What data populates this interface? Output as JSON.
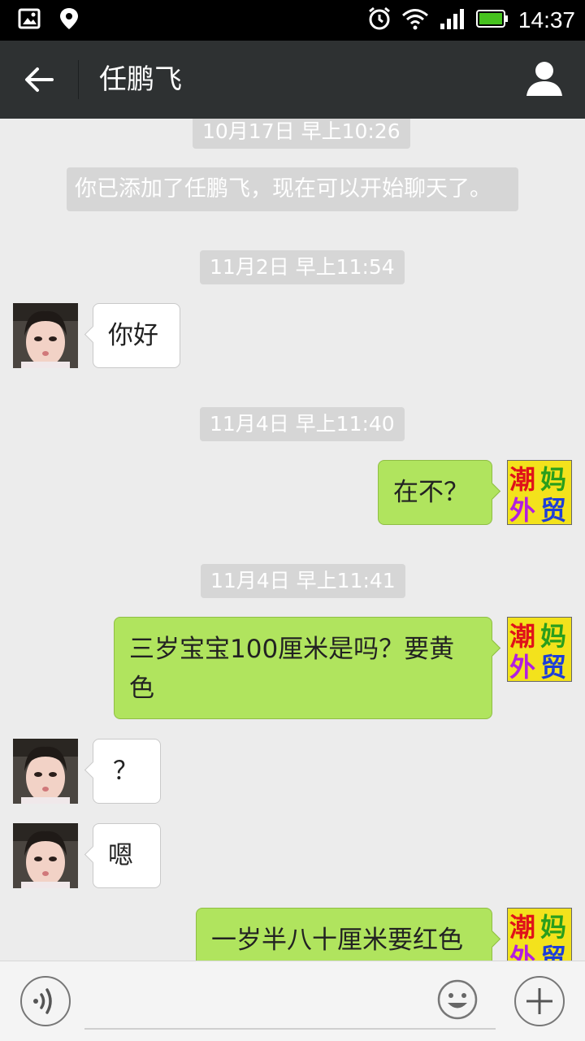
{
  "status_bar": {
    "time": "14:37",
    "left_icons": [
      "image-icon",
      "map-pin-icon"
    ],
    "right_icons": [
      "alarm-icon",
      "wifi-icon",
      "signal-icon",
      "battery-icon"
    ]
  },
  "header": {
    "title": "任鹏飞",
    "back_icon": "back-arrow-icon",
    "profile_icon": "person-icon"
  },
  "chat": {
    "timestamps": [
      "10月17日 早上10:26",
      "11月2日 早上11:54",
      "11月4日 早上11:40",
      "11月4日 早上11:41"
    ],
    "system_message": "你已添加了任鹏飞，现在可以开始聊天了。",
    "messages": [
      {
        "from": "contact",
        "text": "你好"
      },
      {
        "from": "me",
        "text": "在不？"
      },
      {
        "from": "me",
        "text": "三岁宝宝100厘米是吗？要黄色"
      },
      {
        "from": "contact",
        "text": "？"
      },
      {
        "from": "contact",
        "text": "嗯"
      },
      {
        "from": "me",
        "text": "一岁半八十厘米要红色"
      }
    ],
    "my_avatar_logo": [
      "潮",
      "妈",
      "外",
      "贸"
    ]
  },
  "input_bar": {
    "voice_icon": "voice-icon",
    "emoji_icon": "emoji-icon",
    "plus_icon": "plus-icon",
    "text_value": ""
  },
  "colors": {
    "header_bg": "#2e3132",
    "chat_bg": "#ececec",
    "outgoing_bubble": "#b0e45e",
    "incoming_bubble": "#ffffff",
    "timestamp_bg": "#d6d6d6"
  }
}
